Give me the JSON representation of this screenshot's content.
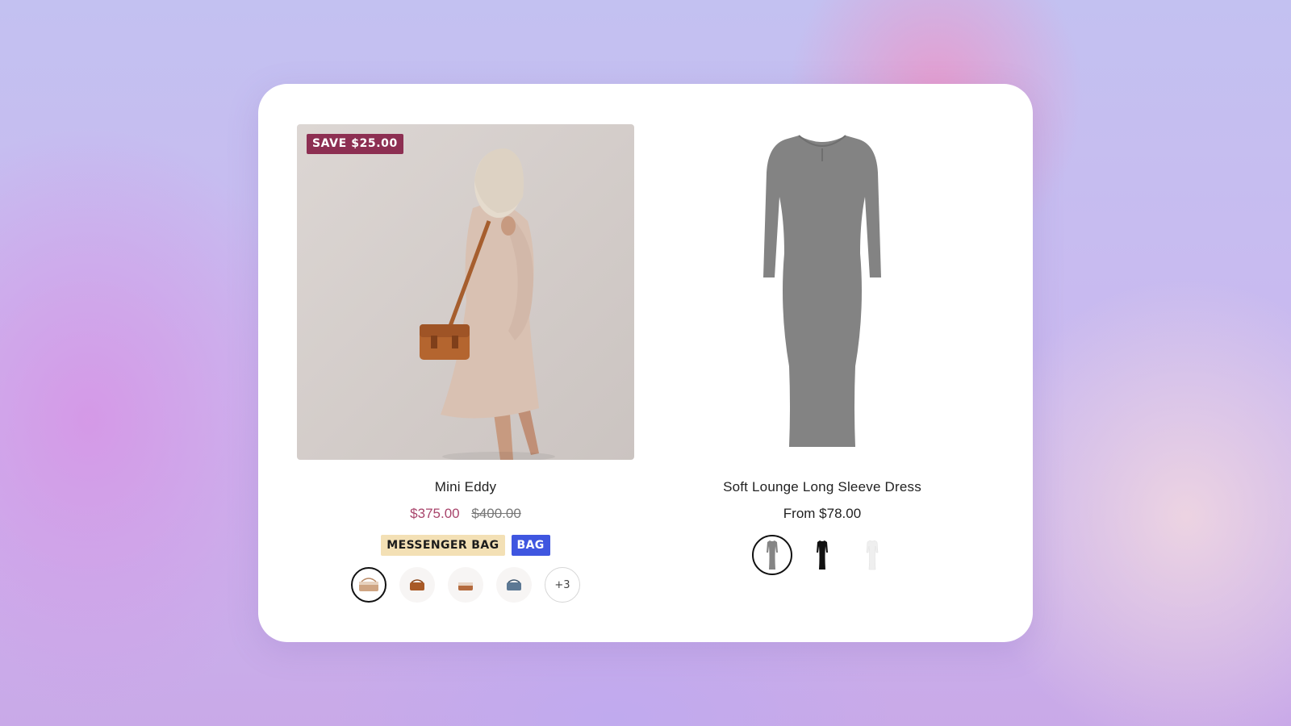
{
  "products": [
    {
      "badge": "SAVE $25.00",
      "title": "Mini Eddy",
      "price": "$375.00",
      "compare_price": "$400.00",
      "tags": [
        "MESSENGER BAG",
        "BAG"
      ],
      "swatches": [
        "bag-tan",
        "bag-cognac",
        "bag-rust",
        "bag-denim"
      ],
      "more_swatches": "+3",
      "colors": {
        "badge": "#8d2f52",
        "sale_price": "#a8446b",
        "tag_messenger": "#f3e0b5",
        "tag_bag": "#3f56e0"
      }
    },
    {
      "title": "Soft Lounge Long Sleeve Dress",
      "price": "From $78.00",
      "swatches": [
        "dress-gray",
        "dress-black",
        "dress-white"
      ]
    }
  ]
}
